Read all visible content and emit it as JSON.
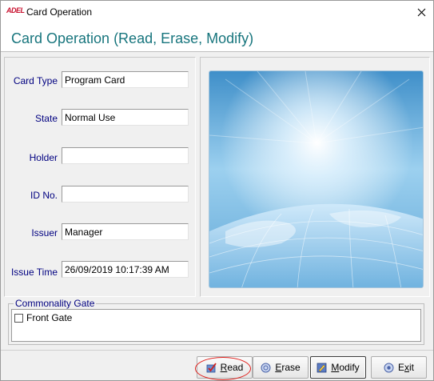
{
  "window": {
    "title": "Card Operation",
    "app_logo_text": "ADEL"
  },
  "header": {
    "title": "Card Operation (Read, Erase, Modify)"
  },
  "form": {
    "fields": [
      {
        "label": "Card Type",
        "value": "Program Card"
      },
      {
        "label": "State",
        "value": "Normal Use"
      },
      {
        "label": "Holder",
        "value": ""
      },
      {
        "label": "ID No.",
        "value": ""
      },
      {
        "label": "Issuer",
        "value": "Manager"
      },
      {
        "label": "Issue Time",
        "value": "26/09/2019 10:17:39 AM"
      }
    ]
  },
  "gate": {
    "legend": "Commonality Gate",
    "items": [
      {
        "label": "Front Gate",
        "checked": false
      }
    ]
  },
  "buttons": {
    "read": {
      "label": "Read",
      "mnemonic": "R",
      "rest": "ead"
    },
    "erase": {
      "label": "Erase",
      "mnemonic": "E",
      "rest": "rase"
    },
    "modify": {
      "label": "Modify",
      "mnemonic": "M",
      "rest": "odify"
    },
    "exit": {
      "label": "Exit",
      "mnemonic": "x",
      "pre": "E",
      "rest": "it"
    }
  },
  "colors": {
    "title_accent": "#17757d",
    "label_color": "#000080",
    "highlight": "#e0201c"
  }
}
